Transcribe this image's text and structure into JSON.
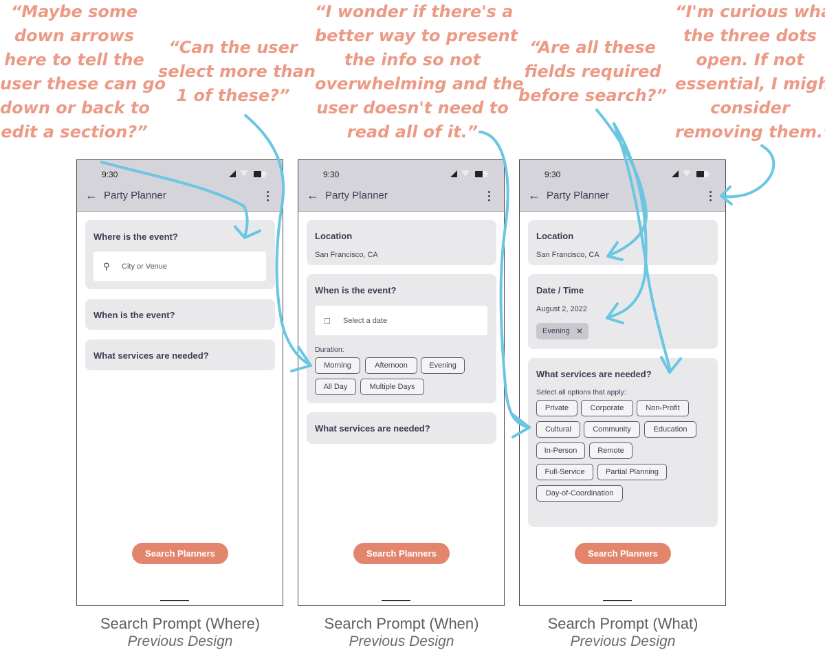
{
  "annotations": {
    "a1": [
      "“Maybe some",
      "down arrows",
      "here to tell the",
      "user these can go",
      "down or back to",
      "edit a section?”"
    ],
    "a2": [
      "“Can the user",
      "select more than",
      "1 of these?”"
    ],
    "a3": [
      "“I wonder if there's a",
      "better way to present",
      "the info so not",
      "overwhelming and the",
      "user doesn't need to",
      "read all of it.”"
    ],
    "a4": [
      "“Are all these",
      "fields required",
      "before search?”"
    ],
    "a5": [
      "“I'm curious what",
      "the three dots",
      "open. If not",
      "essential, I might",
      "consider",
      "removing them.”"
    ]
  },
  "status": {
    "time": "9:30"
  },
  "app": {
    "title": "Party Planner"
  },
  "search_button": "Search Planners",
  "where_screen": {
    "q1": "Where is the event?",
    "search_placeholder": "City or Venue",
    "q2": "When is the event?",
    "q3": "What services are needed?"
  },
  "when_screen": {
    "location_label": "Location",
    "location_value": "San Francisco, CA",
    "q2": "When is the event?",
    "date_placeholder": "Select a date",
    "duration_label": "Duration:",
    "durations": [
      "Morning",
      "Afternoon",
      "Evening",
      "All Day",
      "Multiple Days"
    ],
    "q3": "What services are needed?"
  },
  "what_screen": {
    "location_label": "Location",
    "location_value": "San Francisco, CA",
    "datetime_label": "Date / Time",
    "date_value": "August 2, 2022",
    "selected_chip": "Evening",
    "q3": "What services are needed?",
    "select_hint": "Select all options that apply:",
    "services": [
      "Private",
      "Corporate",
      "Non-Profit",
      "Cultural",
      "Community",
      "Education",
      "In-Person",
      "Remote",
      "Full-Service",
      "Partial Planning",
      "Day-of-Coordination"
    ]
  },
  "captions": [
    {
      "title": "Search Prompt (Where)",
      "sub": "Previous Design"
    },
    {
      "title": "Search Prompt (When)",
      "sub": "Previous Design"
    },
    {
      "title": "Search Prompt (What)",
      "sub": "Previous Design"
    }
  ],
  "colors": {
    "annotation": "#ec9a86",
    "arrow": "#6ac6e2",
    "accent_button": "#e2856c",
    "card": "#e9e9ec",
    "app_bar": "#d4d4da"
  }
}
